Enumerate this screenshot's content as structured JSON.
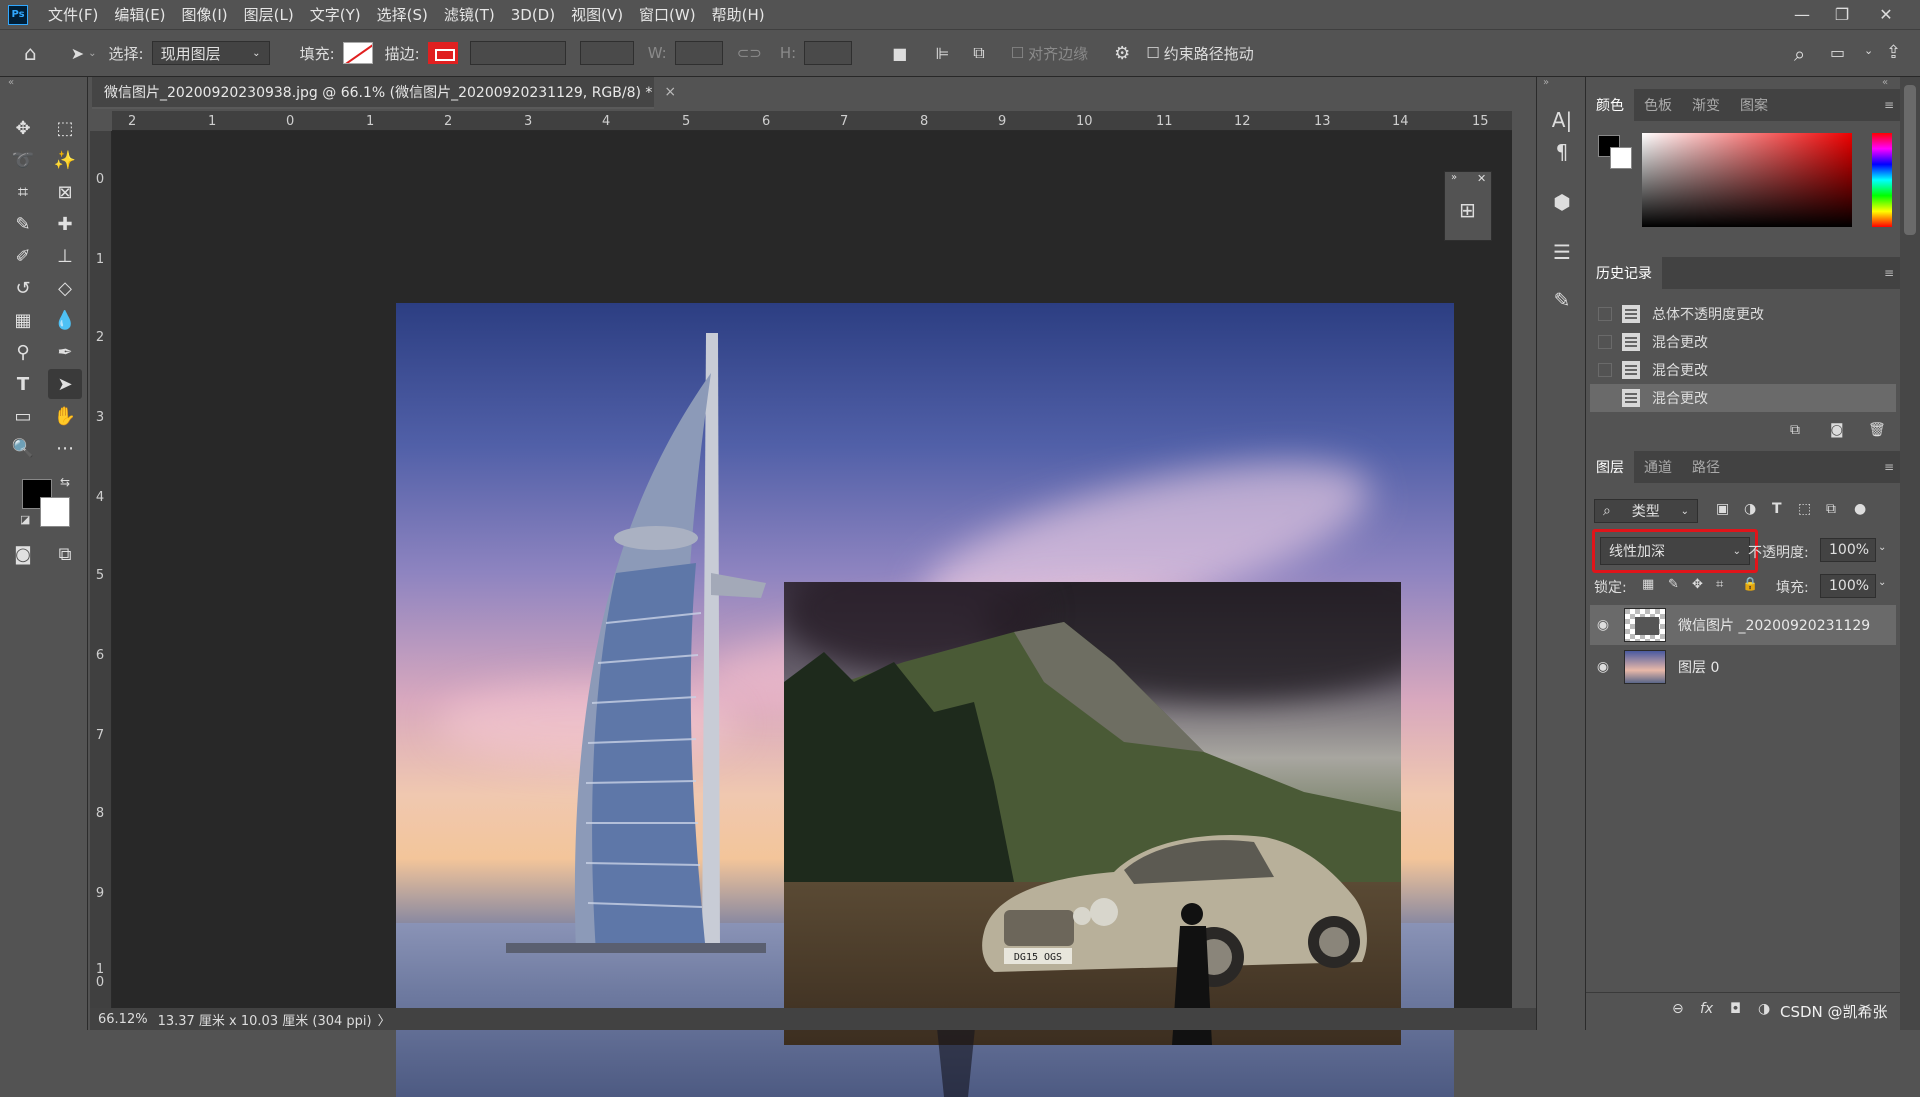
{
  "app": {
    "logo": "Ps"
  },
  "menu": [
    "文件(F)",
    "编辑(E)",
    "图像(I)",
    "图层(L)",
    "文字(Y)",
    "选择(S)",
    "滤镜(T)",
    "3D(D)",
    "视图(V)",
    "窗口(W)",
    "帮助(H)"
  ],
  "window_controls": {
    "minimize": "—",
    "restore": "❐",
    "close": "✕"
  },
  "options": {
    "select_label": "选择:",
    "select_value": "现用图层",
    "fill_label": "填充:",
    "stroke_label": "描边:",
    "w_label": "W:",
    "h_label": "H:",
    "align_edges": "对齐边缘",
    "constrain_path": "约束路径拖动"
  },
  "document": {
    "tab_title": "微信图片_20200920230938.jpg @ 66.1% (微信图片_20200920231129, RGB/8) *",
    "close": "×",
    "zoom": "66.12%",
    "size_info": "13.37 厘米 x 10.03 厘米 (304 ppi)",
    "status_arrow": "〉"
  },
  "rulers": {
    "horizontal": [
      "2",
      "1",
      "0",
      "1",
      "2",
      "3",
      "4",
      "5",
      "6",
      "7",
      "8",
      "9",
      "10",
      "11",
      "12",
      "13",
      "14",
      "15"
    ],
    "vertical": [
      "0",
      "1",
      "2",
      "3",
      "4",
      "5",
      "6",
      "7",
      "8",
      "9",
      "1\n0"
    ]
  },
  "car_plate": "DG15 OGS",
  "color_panel": {
    "tabs": [
      "颜色",
      "色板",
      "渐变",
      "图案"
    ]
  },
  "history_panel": {
    "title": "历史记录",
    "items": [
      "总体不透明度更改",
      "混合更改",
      "混合更改",
      "混合更改"
    ]
  },
  "layers_panel": {
    "tabs": [
      "图层",
      "通道",
      "路径"
    ],
    "filter_label": "类型",
    "blend_mode": "线性加深",
    "opacity_label": "不透明度:",
    "opacity_value": "100%",
    "lock_label": "锁定:",
    "fill_label": "填充:",
    "fill_value": "100%",
    "layers": [
      {
        "name": "微信图片 _20200920231129"
      },
      {
        "name": "图层 0"
      }
    ],
    "footer_icons": [
      "⊖",
      "fx",
      "◘",
      "◑"
    ]
  },
  "watermark": "CSDN @凯希张",
  "colors": {
    "highlight": "#e0141a",
    "panel_bg": "#535353",
    "canvas_bg": "#282828"
  }
}
